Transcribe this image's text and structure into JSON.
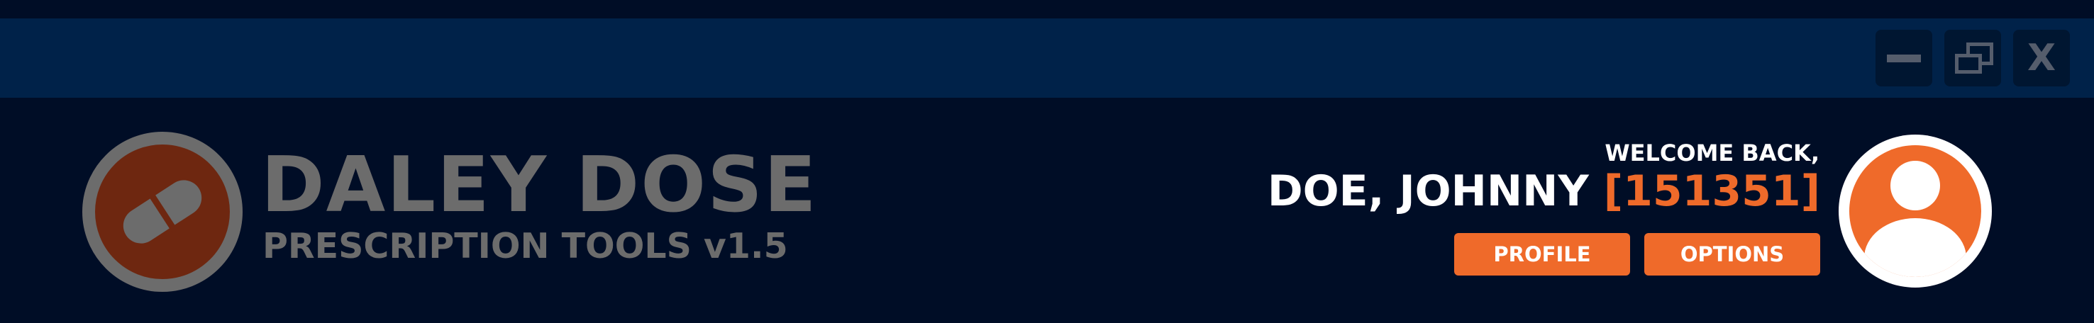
{
  "window_controls": {
    "minimize": {
      "icon": "minimize-icon"
    },
    "restore": {
      "icon": "restore-icon"
    },
    "close": {
      "label": "X",
      "icon": "close-icon"
    }
  },
  "brand": {
    "title": "DALEY DOSE",
    "subtitle": "PRESCRIPTION TOOLS v1.5",
    "logo_icon": "pill-icon"
  },
  "user": {
    "welcome": "WELCOME BACK,",
    "name": "DOE, JOHNNY",
    "id": "[151351]",
    "avatar_icon": "user-avatar-icon"
  },
  "actions": {
    "profile_label": "PROFILE",
    "options_label": "OPTIONS"
  },
  "colors": {
    "background": "#000d26",
    "title_bar": "#002249",
    "accent": "#ef6a2a",
    "brand_gray": "#6c6c6c",
    "logo_fill": "#6e2710"
  }
}
